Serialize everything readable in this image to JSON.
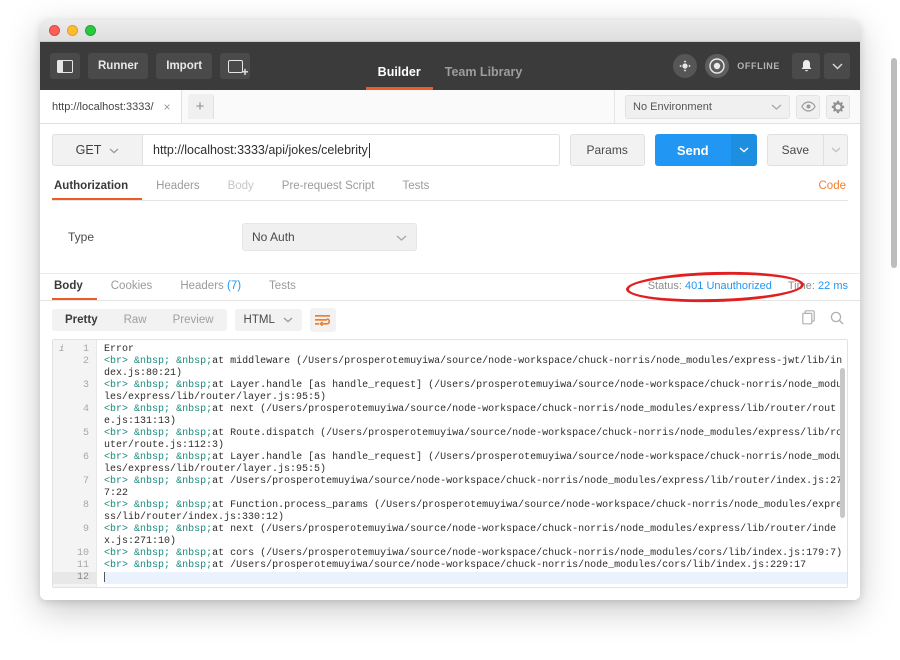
{
  "window": {
    "traffic_lights": [
      "close",
      "minimize",
      "maximize"
    ]
  },
  "header": {
    "sidebar_toggle": "sidebar-toggle",
    "runner_label": "Runner",
    "import_label": "Import",
    "new_tab_label": "new-window",
    "tabs": [
      {
        "label": "Builder",
        "active": true
      },
      {
        "label": "Team Library",
        "active": false
      }
    ],
    "sync_icon": "sync-icon",
    "status_icon": "record-icon",
    "offline_label": "OFFLINE",
    "bell_icon": "bell-icon",
    "chevron_icon": "chevron-down-icon"
  },
  "tabstrip": {
    "request_tab": "http://localhost:3333/",
    "close_glyph": "×",
    "add_glyph": "+",
    "environment": "No Environment",
    "eye_icon": "eye-icon",
    "gear_icon": "gear-icon"
  },
  "request": {
    "method": "GET",
    "url": "http://localhost:3333/api/jokes/celebrity",
    "params_label": "Params",
    "send_label": "Send",
    "save_label": "Save",
    "tabs": [
      {
        "label": "Authorization",
        "active": true,
        "dim": false
      },
      {
        "label": "Headers",
        "active": false,
        "dim": false
      },
      {
        "label": "Body",
        "active": false,
        "dim": true
      },
      {
        "label": "Pre-request Script",
        "active": false,
        "dim": false
      },
      {
        "label": "Tests",
        "active": false,
        "dim": false
      }
    ],
    "code_link": "Code"
  },
  "auth": {
    "type_label": "Type",
    "type_value": "No Auth"
  },
  "response": {
    "tabs": [
      {
        "label": "Body",
        "active": true,
        "badge": ""
      },
      {
        "label": "Cookies",
        "active": false,
        "badge": ""
      },
      {
        "label": "Headers",
        "active": false,
        "badge": "(7)"
      },
      {
        "label": "Tests",
        "active": false,
        "badge": ""
      }
    ],
    "status_label": "Status:",
    "status_value": "401 Unauthorized",
    "time_label": "Time:",
    "time_value": "22 ms",
    "highlight_color": "#e02020"
  },
  "body_toolbar": {
    "views": [
      {
        "label": "Pretty",
        "active": true
      },
      {
        "label": "Raw",
        "active": false
      },
      {
        "label": "Preview",
        "active": false
      }
    ],
    "format": "HTML",
    "wrap_icon": "word-wrap-icon",
    "copy_icon": "copy-icon",
    "search_icon": "search-icon"
  },
  "editor": {
    "fold_marker": "i",
    "current_line": 12,
    "lines": [
      {
        "n": 1,
        "segments": [
          {
            "t": "text",
            "v": "Error"
          }
        ]
      },
      {
        "n": 2,
        "segments": [
          {
            "t": "tag",
            "v": "<br>"
          },
          {
            "t": "text",
            "v": " "
          },
          {
            "t": "ent",
            "v": "&nbsp;"
          },
          {
            "t": "text",
            "v": " "
          },
          {
            "t": "ent",
            "v": "&nbsp;"
          },
          {
            "t": "text",
            "v": "at middleware (/Users/prosperotemuyiwa/source/node-workspace/chuck-norris/node_modules/express-jwt/lib/index.js:80:21)"
          }
        ]
      },
      {
        "n": 3,
        "segments": [
          {
            "t": "tag",
            "v": "<br>"
          },
          {
            "t": "text",
            "v": " "
          },
          {
            "t": "ent",
            "v": "&nbsp;"
          },
          {
            "t": "text",
            "v": " "
          },
          {
            "t": "ent",
            "v": "&nbsp;"
          },
          {
            "t": "text",
            "v": "at Layer.handle [as handle_request] (/Users/prosperotemuyiwa/source/node-workspace/chuck-norris/node_modules/express/lib/router/layer.js:95:5)"
          }
        ]
      },
      {
        "n": 4,
        "segments": [
          {
            "t": "tag",
            "v": "<br>"
          },
          {
            "t": "text",
            "v": " "
          },
          {
            "t": "ent",
            "v": "&nbsp;"
          },
          {
            "t": "text",
            "v": " "
          },
          {
            "t": "ent",
            "v": "&nbsp;"
          },
          {
            "t": "text",
            "v": "at next (/Users/prosperotemuyiwa/source/node-workspace/chuck-norris/node_modules/express/lib/router/route.js:131:13)"
          }
        ]
      },
      {
        "n": 5,
        "segments": [
          {
            "t": "tag",
            "v": "<br>"
          },
          {
            "t": "text",
            "v": " "
          },
          {
            "t": "ent",
            "v": "&nbsp;"
          },
          {
            "t": "text",
            "v": " "
          },
          {
            "t": "ent",
            "v": "&nbsp;"
          },
          {
            "t": "text",
            "v": "at Route.dispatch (/Users/prosperotemuyiwa/source/node-workspace/chuck-norris/node_modules/express/lib/router/route.js:112:3)"
          }
        ]
      },
      {
        "n": 6,
        "segments": [
          {
            "t": "tag",
            "v": "<br>"
          },
          {
            "t": "text",
            "v": " "
          },
          {
            "t": "ent",
            "v": "&nbsp;"
          },
          {
            "t": "text",
            "v": " "
          },
          {
            "t": "ent",
            "v": "&nbsp;"
          },
          {
            "t": "text",
            "v": "at Layer.handle [as handle_request] (/Users/prosperotemuyiwa/source/node-workspace/chuck-norris/node_modules/express/lib/router/layer.js:95:5)"
          }
        ]
      },
      {
        "n": 7,
        "segments": [
          {
            "t": "tag",
            "v": "<br>"
          },
          {
            "t": "text",
            "v": " "
          },
          {
            "t": "ent",
            "v": "&nbsp;"
          },
          {
            "t": "text",
            "v": " "
          },
          {
            "t": "ent",
            "v": "&nbsp;"
          },
          {
            "t": "text",
            "v": "at /Users/prosperotemuyiwa/source/node-workspace/chuck-norris/node_modules/express/lib/router/index.js:277:22"
          }
        ]
      },
      {
        "n": 8,
        "segments": [
          {
            "t": "tag",
            "v": "<br>"
          },
          {
            "t": "text",
            "v": " "
          },
          {
            "t": "ent",
            "v": "&nbsp;"
          },
          {
            "t": "text",
            "v": " "
          },
          {
            "t": "ent",
            "v": "&nbsp;"
          },
          {
            "t": "text",
            "v": "at Function.process_params (/Users/prosperotemuyiwa/source/node-workspace/chuck-norris/node_modules/express/lib/router/index.js:330:12)"
          }
        ]
      },
      {
        "n": 9,
        "segments": [
          {
            "t": "tag",
            "v": "<br>"
          },
          {
            "t": "text",
            "v": " "
          },
          {
            "t": "ent",
            "v": "&nbsp;"
          },
          {
            "t": "text",
            "v": " "
          },
          {
            "t": "ent",
            "v": "&nbsp;"
          },
          {
            "t": "text",
            "v": "at next (/Users/prosperotemuyiwa/source/node-workspace/chuck-norris/node_modules/express/lib/router/index.js:271:10)"
          }
        ]
      },
      {
        "n": 10,
        "segments": [
          {
            "t": "tag",
            "v": "<br>"
          },
          {
            "t": "text",
            "v": " "
          },
          {
            "t": "ent",
            "v": "&nbsp;"
          },
          {
            "t": "text",
            "v": " "
          },
          {
            "t": "ent",
            "v": "&nbsp;"
          },
          {
            "t": "text",
            "v": "at cors (/Users/prosperotemuyiwa/source/node-workspace/chuck-norris/node_modules/cors/lib/index.js:179:7)"
          }
        ]
      },
      {
        "n": 11,
        "segments": [
          {
            "t": "tag",
            "v": "<br>"
          },
          {
            "t": "text",
            "v": " "
          },
          {
            "t": "ent",
            "v": "&nbsp;"
          },
          {
            "t": "text",
            "v": " "
          },
          {
            "t": "ent",
            "v": "&nbsp;"
          },
          {
            "t": "text",
            "v": "at /Users/prosperotemuyiwa/source/node-workspace/chuck-norris/node_modules/cors/lib/index.js:229:17"
          }
        ]
      },
      {
        "n": 12,
        "segments": []
      }
    ]
  }
}
